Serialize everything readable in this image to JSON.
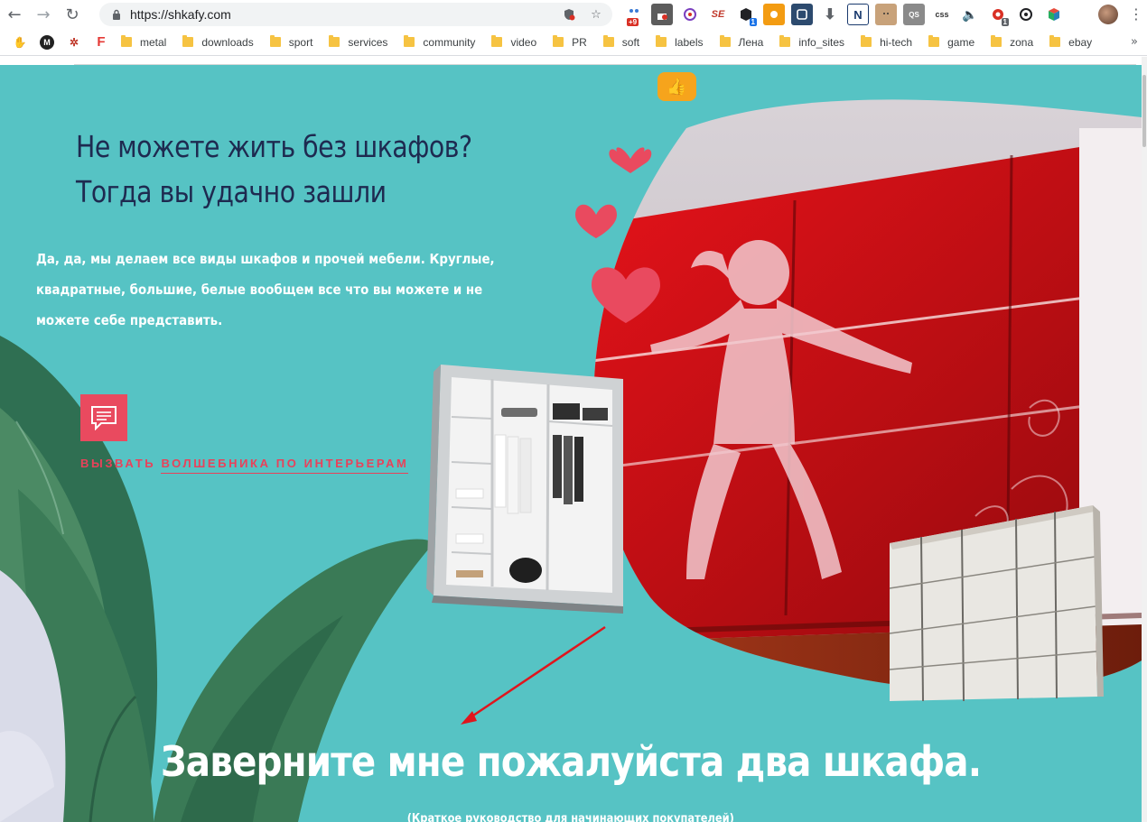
{
  "browser": {
    "url": "https://shkafy.com",
    "bookmarks": [
      "metal",
      "downloads",
      "sport",
      "services",
      "community",
      "video",
      "PR",
      "soft",
      "labels",
      "Лена",
      "info_sites",
      "hi-tech",
      "game",
      "zona",
      "ebay"
    ],
    "extensions": [
      {
        "icon": "weather-icon",
        "badge": "+9"
      },
      {
        "icon": "lock-ext-icon",
        "badge": ""
      },
      {
        "icon": "ghost-icon",
        "badge": ""
      },
      {
        "icon": "se-icon",
        "badge": ""
      },
      {
        "icon": "box-icon",
        "badge": "1"
      },
      {
        "icon": "orange-icon",
        "badge": ""
      },
      {
        "icon": "frame-icon",
        "badge": ""
      },
      {
        "icon": "download-icon",
        "badge": ""
      },
      {
        "icon": "n-icon",
        "badge": ""
      },
      {
        "icon": "face-icon",
        "badge": ""
      },
      {
        "icon": "qs-icon",
        "badge": ""
      },
      {
        "icon": "css-icon",
        "badge": ""
      },
      {
        "icon": "volume-icon",
        "badge": ""
      },
      {
        "icon": "record-icon",
        "badge": "1"
      },
      {
        "icon": "at-icon",
        "badge": ""
      },
      {
        "icon": "cube-icon",
        "badge": ""
      }
    ],
    "ext_labels": {
      "se": "SE",
      "n": "N",
      "qs": "QS",
      "css": "css",
      "badge_weather": "+9",
      "badge_box": "1",
      "badge_record": "1"
    }
  },
  "hero": {
    "title_line1": "Не можете жить без шкафов?",
    "title_line2": "Тогда вы удачно зашли",
    "description": "Да, да, мы делаем все виды шкафов и прочей мебели. Круглые, квадратные, большие, белые вообщем все что вы можете и не можете себе представить.",
    "cta_word1": "ВЫЗВАТЬ",
    "cta_word2": "ВОЛШЕБНИКА ПО ИНТЕРЬЕРАМ"
  },
  "section": {
    "title": "Заверните мне пожалуйста два шкафа.",
    "subtitle": "(Краткое руководство для начинающих покупателей)"
  },
  "colors": {
    "teal": "#56c3c4",
    "navy": "#1e2a50",
    "accent_red": "#e9415a",
    "like_orange": "#f6a41c"
  }
}
